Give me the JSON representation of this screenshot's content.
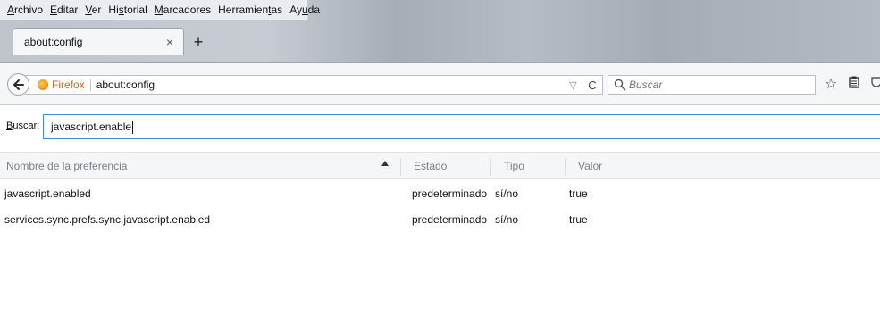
{
  "menubar": {
    "items": [
      {
        "pre": "",
        "acc": "A",
        "post": "rchivo"
      },
      {
        "pre": "",
        "acc": "E",
        "post": "ditar"
      },
      {
        "pre": "",
        "acc": "V",
        "post": "er"
      },
      {
        "pre": "Hi",
        "acc": "s",
        "post": "torial"
      },
      {
        "pre": "",
        "acc": "M",
        "post": "arcadores"
      },
      {
        "pre": "Herramien",
        "acc": "t",
        "post": "as"
      },
      {
        "pre": "Ay",
        "acc": "u",
        "post": "da"
      }
    ]
  },
  "tab": {
    "title": "about:config",
    "close_glyph": "×",
    "newtab_glyph": "+"
  },
  "navbar": {
    "identity_label": "Firefox",
    "url": "about:config",
    "dropmarker_glyph": "▽",
    "reload_glyph": "C",
    "search_placeholder": "Buscar",
    "bookmark_glyph": "☆"
  },
  "config": {
    "filter_label_acc": "B",
    "filter_label_rest": "uscar:",
    "filter_value": "javascript.enable",
    "columns": {
      "name": "Nombre de la preferencia",
      "status": "Estado",
      "type": "Tipo",
      "value": "Valor"
    },
    "rows": [
      {
        "name": "javascript.enabled",
        "status": "predeterminado",
        "type": "sí/no",
        "value": "true"
      },
      {
        "name": "services.sync.prefs.sync.javascript.enabled",
        "status": "predeterminado",
        "type": "sí/no",
        "value": "true"
      }
    ]
  }
}
